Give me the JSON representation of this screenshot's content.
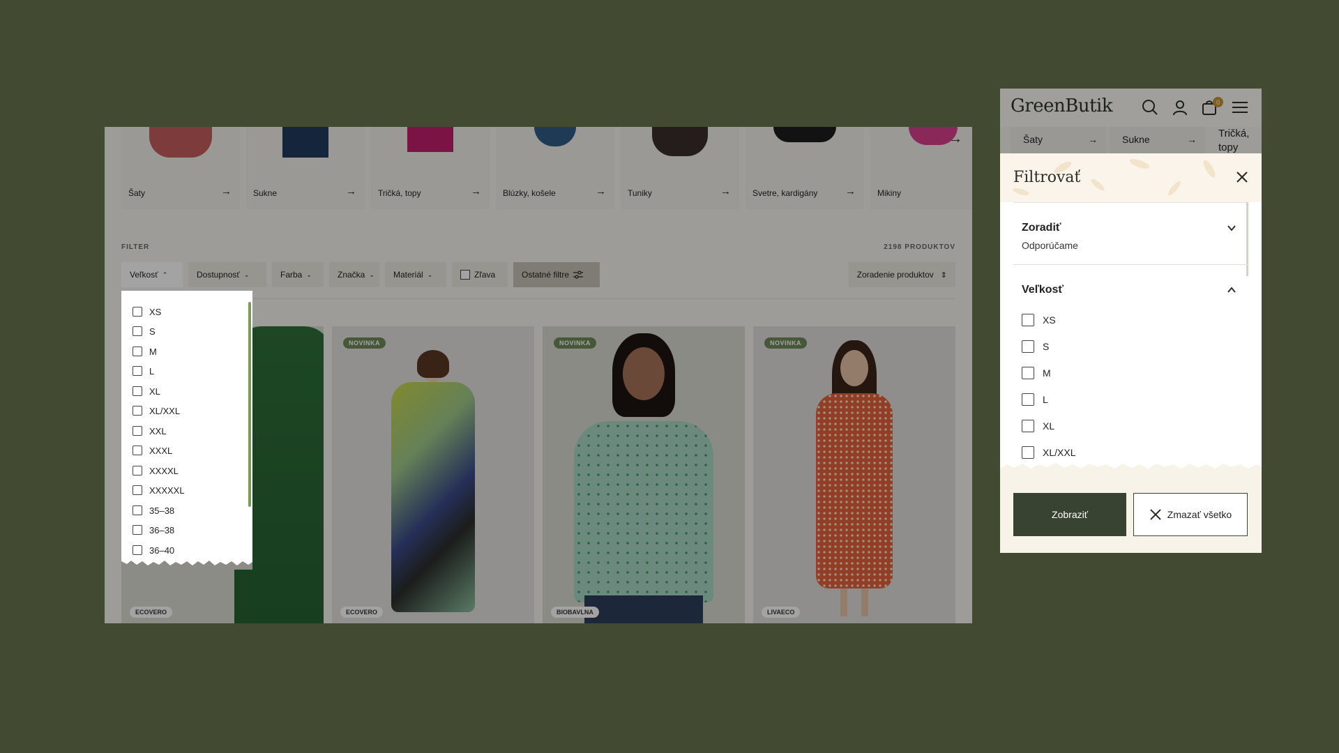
{
  "colors": {
    "background": "#434a32",
    "accent": "#384431",
    "badge": "#6f8a58",
    "cart_badge": "#c9952f"
  },
  "desktop": {
    "categories": [
      {
        "label": "Šaty",
        "icon": "arrow-right-icon"
      },
      {
        "label": "Sukne",
        "icon": "arrow-right-icon"
      },
      {
        "label": "Tričká, topy",
        "icon": "arrow-right-icon"
      },
      {
        "label": "Blúzky, košele",
        "icon": "arrow-right-icon"
      },
      {
        "label": "Tuniky",
        "icon": "arrow-right-icon"
      },
      {
        "label": "Svetre, kardigány",
        "icon": "arrow-right-icon"
      },
      {
        "label": "Mikiny",
        "icon": "arrow-right-icon"
      }
    ],
    "filter_label": "FILTER",
    "product_count": "2198 PRODUKTOV",
    "filters": {
      "size": "Veľkosť",
      "availability": "Dostupnosť",
      "color": "Farba",
      "brand": "Značka",
      "material": "Materiál",
      "discount": "Zľava",
      "other": "Ostatné filtre"
    },
    "sort_label": "Zoradenie produktov",
    "size_options": [
      "XS",
      "S",
      "M",
      "L",
      "XL",
      "XL/XXL",
      "XXL",
      "XXXL",
      "XXXXL",
      "XXXXXL",
      "35–38",
      "36–38",
      "36–40"
    ],
    "products": [
      {
        "badge": "",
        "tag": "ECOVERO"
      },
      {
        "badge": "NOVINKA",
        "tag": "ECOVERO"
      },
      {
        "badge": "NOVINKA",
        "tag": "BIOBAVLNA"
      },
      {
        "badge": "NOVINKA",
        "tag": "LIVAECO"
      }
    ]
  },
  "mobile": {
    "logo": "GreenButik",
    "cart_count": "0",
    "categories": [
      "Šaty",
      "Sukne",
      "Tričká, topy"
    ],
    "panel": {
      "title": "Filtrovať",
      "sort_title": "Zoradiť",
      "sort_value": "Odporúčame",
      "size_title": "Veľkosť",
      "size_options": [
        "XS",
        "S",
        "M",
        "L",
        "XL",
        "XL/XXL"
      ],
      "show_button": "Zobraziť",
      "clear_button": "Zmazať všetko"
    }
  }
}
